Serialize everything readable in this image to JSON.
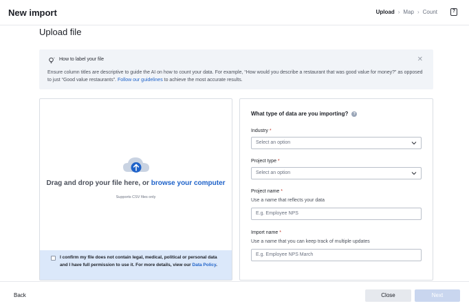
{
  "header": {
    "title": "New import",
    "steps": [
      "Upload",
      "Map",
      "Count"
    ],
    "active_step": "Upload",
    "help_icon": "question-icon"
  },
  "page_title": "Upload file",
  "banner": {
    "icon": "lightbulb-icon",
    "title": "How to label your file",
    "body_part1": "Ensure column titles are descriptive to guide the AI on how to count your data. For example, “How would you describe a restaurant that was good value for money?” as opposed to just “Good value restaurants”. ",
    "link": "Follow our guidelines",
    "body_part2": " to achieve the most accurate results."
  },
  "dropzone": {
    "icon": "cloud-upload-icon",
    "text": "Drag and drop your file here, or ",
    "link": "browse your computer",
    "subtext": "Supports CSV files only",
    "confirm_text": "I confirm my file does not contain legal, medical, political or personal data and I have full permission to use it. For more details, view our ",
    "confirm_link": "Data Policy",
    "confirm_end": "."
  },
  "form": {
    "title": "What type of data are you importing?",
    "industry": {
      "label": "Industry",
      "placeholder": "Select an option"
    },
    "project_type": {
      "label": "Project type",
      "placeholder": "Select an option"
    },
    "project_name": {
      "label": "Project name",
      "hint": "Use a name that reflects your data",
      "placeholder": "E.g. Employee NPS"
    },
    "import_name": {
      "label": "Import name",
      "hint": "Use a name that you can keep track of multiple updates",
      "placeholder": "E.g. Employee NPS March"
    }
  },
  "footer": {
    "back": "Back",
    "close": "Close",
    "next": "Next"
  },
  "colors": {
    "accent": "#1e62c9",
    "banner_bg": "#f1f4f8",
    "confirm_bg": "#dbe8fa",
    "next_disabled": "#c9d6ef"
  }
}
